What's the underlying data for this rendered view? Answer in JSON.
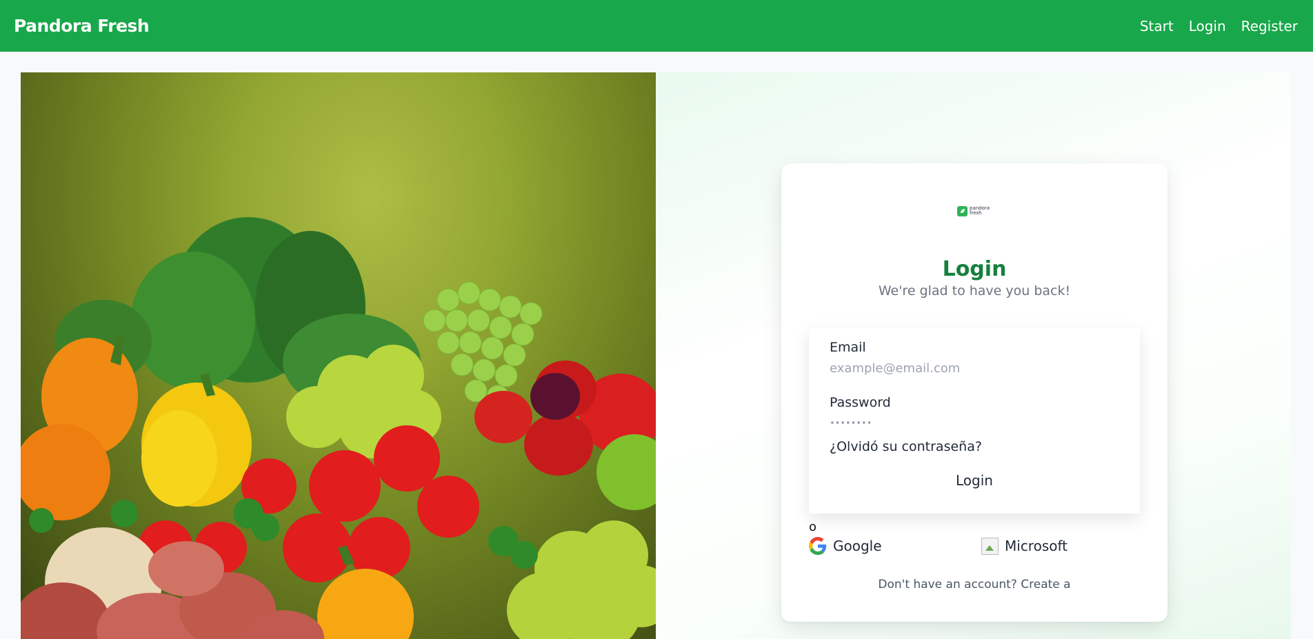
{
  "navbar": {
    "brand": "Pandora Fresh",
    "links": [
      "Start",
      "Login",
      "Register"
    ],
    "bg_color": "#18a74a"
  },
  "hero": {
    "image": "fresh-vegetables-and-fruits-photo"
  },
  "login_card": {
    "logo_text_line1": "pandora",
    "logo_text_line2": "fresh",
    "title": "Login",
    "subtitle": "We're glad to have you back!",
    "email_label": "Email",
    "email_placeholder": "example@email.com",
    "password_label": "Password",
    "password_placeholder": "••••••••",
    "forgot_link": "¿Olvidó su contraseña?",
    "login_button": "Login",
    "or_text": "o",
    "google_label": "Google",
    "microsoft_label": "Microsoft",
    "signup_prefix": "Don't have an account?",
    "signup_link": "Create a"
  },
  "colors": {
    "accent": "#15803d",
    "brand_green": "#18a74a"
  }
}
